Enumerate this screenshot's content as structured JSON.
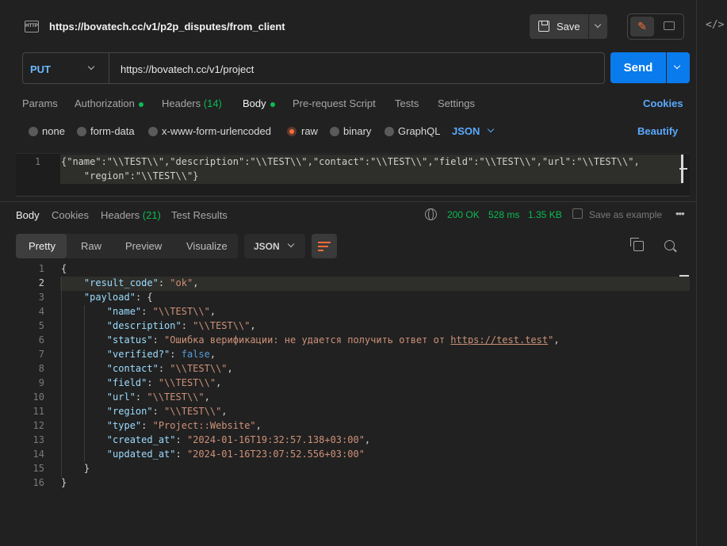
{
  "request": {
    "title": "https://bovatech.cc/v1/p2p_disputes/from_client",
    "save_label": "Save",
    "method": "PUT",
    "url": "https://bovatech.cc/v1/project",
    "send_label": "Send",
    "http_badge": "HTTP"
  },
  "request_tabs": [
    {
      "label": "Params"
    },
    {
      "label": "Authorization"
    },
    {
      "label": "Headers",
      "count": "(14)"
    },
    {
      "label": "Body"
    },
    {
      "label": "Pre-request Script"
    },
    {
      "label": "Tests"
    },
    {
      "label": "Settings"
    }
  ],
  "cookies_label": "Cookies",
  "body_types": [
    "none",
    "form-data",
    "x-www-form-urlencoded",
    "raw",
    "binary",
    "GraphQL"
  ],
  "body_format": "JSON",
  "beautify_label": "Beautify",
  "request_body": {
    "line_number": "1",
    "line_1": "{\"name\":\"\\\\TEST\\\\\",\"description\":\"\\\\TEST\\\\\",\"contact\":\"\\\\TEST\\\\\",\"field\":\"\\\\TEST\\\\\",\"url\":\"\\\\TEST\\\\\",",
    "line_2": "    \"region\":\"\\\\TEST\\\\\"}"
  },
  "response_tabs": [
    {
      "label": "Body"
    },
    {
      "label": "Cookies"
    },
    {
      "label": "Headers",
      "count": "(21)"
    },
    {
      "label": "Test Results"
    }
  ],
  "response_meta": {
    "status": "200 OK",
    "time": "528 ms",
    "size": "1.35 KB",
    "save_example": "Save as example",
    "more": "•••"
  },
  "view_tabs": [
    "Pretty",
    "Raw",
    "Preview",
    "Visualize"
  ],
  "response_format": "JSON",
  "response_body": {
    "line_numbers": [
      "1",
      "2",
      "3",
      "4",
      "5",
      "6",
      "7",
      "8",
      "9",
      "10",
      "11",
      "12",
      "13",
      "14",
      "15",
      "16"
    ],
    "lines": {
      "l1": "{",
      "l2_key": "\"result_code\"",
      "l2_val": "\"ok\"",
      "l3_key": "\"payload\"",
      "l4_key": "\"name\"",
      "l4_val": "\"\\\\TEST\\\\\"",
      "l5_key": "\"description\"",
      "l5_val": "\"\\\\TEST\\\\\"",
      "l6_key": "\"status\"",
      "l6_val_pre": "\"Ошибка верификации: не удается получить ответ от ",
      "l6_link": "https://test.test",
      "l6_val_post": "\"",
      "l7_key": "\"verified?\"",
      "l7_val": "false",
      "l8_key": "\"contact\"",
      "l8_val": "\"\\\\TEST\\\\\"",
      "l9_key": "\"field\"",
      "l9_val": "\"\\\\TEST\\\\\"",
      "l10_key": "\"url\"",
      "l10_val": "\"\\\\TEST\\\\\"",
      "l11_key": "\"region\"",
      "l11_val": "\"\\\\TEST\\\\\"",
      "l12_key": "\"type\"",
      "l12_val": "\"Project::Website\"",
      "l13_key": "\"created_at\"",
      "l13_val": "\"2024-01-16T19:32:57.138+03:00\"",
      "l14_key": "\"updated_at\"",
      "l14_val": "\"2024-01-16T23:07:52.556+03:00\"",
      "l15": "}",
      "l16": "}"
    }
  },
  "colors": {
    "accent_orange": "#ff6c37",
    "send_blue": "#097bed",
    "status_green": "#0cbb52",
    "link_blue": "#5aa9ff"
  }
}
